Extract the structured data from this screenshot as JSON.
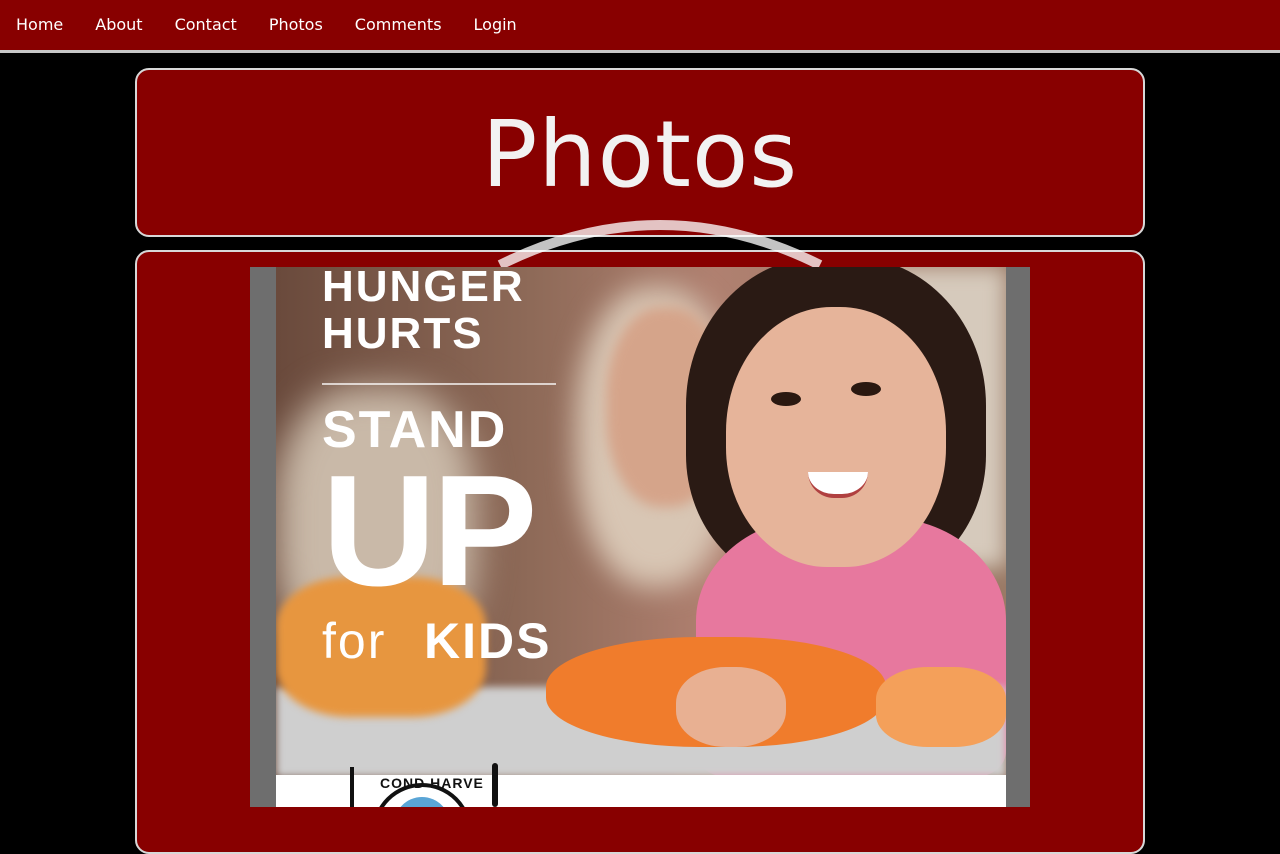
{
  "nav": {
    "items": [
      {
        "label": "Home"
      },
      {
        "label": "About"
      },
      {
        "label": "Contact"
      },
      {
        "label": "Photos"
      },
      {
        "label": "Comments"
      },
      {
        "label": "Login"
      }
    ]
  },
  "header": {
    "title": "Photos"
  },
  "poster": {
    "line1": "HUNGER",
    "line2": "HURTS",
    "line3": "STAND",
    "line4": "UP",
    "line5_for": "for",
    "line5_kids": "KIDS",
    "logo_text": "COND HARVE"
  },
  "colors": {
    "nav_bg": "#880000",
    "panel_bg": "#880000",
    "page_bg": "#000000",
    "border": "#d8d8d8",
    "text": "#ffffff"
  }
}
